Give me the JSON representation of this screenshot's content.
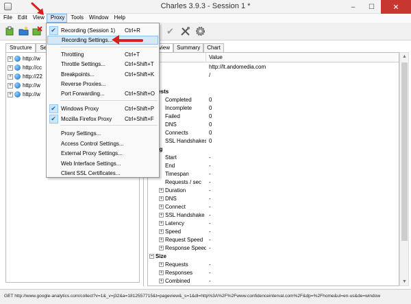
{
  "window": {
    "title": "Charles 3.9.3 - Session 1 *",
    "minimize_glyph": "–",
    "maximize_glyph": "☐",
    "close_glyph": "✕"
  },
  "menubar": [
    "File",
    "Edit",
    "View",
    "Proxy",
    "Tools",
    "Window",
    "Help"
  ],
  "proxy_menu": {
    "items": [
      {
        "label": "Recording (Session 1)",
        "shortcut": "Ctrl+R",
        "checked": true
      },
      {
        "label": "Recording Settings...",
        "shortcut": "",
        "checked": false,
        "highlighted": true
      },
      {
        "label": "Throttling",
        "shortcut": "Ctrl+T",
        "checked": false
      },
      {
        "label": "Throttle Settings...",
        "shortcut": "Ctrl+Shift+T",
        "checked": false
      },
      {
        "label": "Breakpoints...",
        "shortcut": "Ctrl+Shift+K",
        "checked": false
      },
      {
        "label": "Reverse Proxies...",
        "shortcut": "",
        "checked": false
      },
      {
        "label": "Port Forwarding...",
        "shortcut": "Ctrl+Shift+O",
        "checked": false
      },
      {
        "label": "Windows Proxy",
        "shortcut": "Ctrl+Shift+P",
        "checked": true
      },
      {
        "label": "Mozilla Firefox Proxy",
        "shortcut": "Ctrl+Shift+F",
        "checked": true
      },
      {
        "label": "Proxy Settings...",
        "shortcut": "",
        "checked": false
      },
      {
        "label": "Access Control Settings...",
        "shortcut": "",
        "checked": false
      },
      {
        "label": "External Proxy Settings...",
        "shortcut": "",
        "checked": false
      },
      {
        "label": "Web Interface Settings...",
        "shortcut": "",
        "checked": false
      },
      {
        "label": "Client SSL Certificates...",
        "shortcut": "",
        "checked": false
      }
    ],
    "check_glyph": "✔"
  },
  "left_tabs": [
    "Structure",
    "Seq"
  ],
  "tree": [
    "http://w",
    "http://cc",
    "http://22",
    "http://w",
    "http://w"
  ],
  "right_tabs": [
    "view",
    "Summary",
    "Chart"
  ],
  "table": {
    "headers": [
      "",
      "Value"
    ],
    "rows": [
      {
        "key": "ost",
        "value": "http://lt.andomedia.com",
        "level": 0,
        "bold": false
      },
      {
        "key": "ath",
        "value": "/",
        "level": 0,
        "bold": false
      },
      {
        "key": "otes",
        "value": "",
        "level": 0,
        "bold": false
      },
      {
        "key": "equests",
        "value": "",
        "level": 0,
        "bold": true
      },
      {
        "key": "Completed",
        "value": "0",
        "level": 1
      },
      {
        "key": "Incomplete",
        "value": "0",
        "level": 1
      },
      {
        "key": "Failed",
        "value": "0",
        "level": 1
      },
      {
        "key": "DNS",
        "value": "0",
        "level": 1
      },
      {
        "key": "Connects",
        "value": "0",
        "level": 1
      },
      {
        "key": "SSL Handshakes",
        "value": "0",
        "level": 1
      },
      {
        "key": "iming",
        "value": "",
        "level": 0,
        "bold": true
      },
      {
        "key": "Start",
        "value": "-",
        "level": 1
      },
      {
        "key": "End",
        "value": "-",
        "level": 1
      },
      {
        "key": "Timespan",
        "value": "-",
        "level": 1
      },
      {
        "key": "Requests / sec",
        "value": "-",
        "level": 1
      },
      {
        "key": "Duration",
        "value": "-",
        "level": 1,
        "expandable": true
      },
      {
        "key": "DNS",
        "value": "-",
        "level": 1,
        "expandable": true
      },
      {
        "key": "Connect",
        "value": "-",
        "level": 1,
        "expandable": true
      },
      {
        "key": "SSL Handshake",
        "value": "-",
        "level": 1,
        "expandable": true
      },
      {
        "key": "Latency",
        "value": "-",
        "level": 1,
        "expandable": true
      },
      {
        "key": "Speed",
        "value": "-",
        "level": 1,
        "expandable": true
      },
      {
        "key": "Request Speed",
        "value": "-",
        "level": 1,
        "expandable": true
      },
      {
        "key": "Response Speed",
        "value": "-",
        "level": 1,
        "expandable": true
      },
      {
        "key": "Size",
        "value": "",
        "level": 0,
        "bold": true,
        "collapsible": true
      },
      {
        "key": "Requests",
        "value": "-",
        "level": 1,
        "expandable": true
      },
      {
        "key": "Responses",
        "value": "-",
        "level": 1,
        "expandable": true
      },
      {
        "key": "Combined",
        "value": "-",
        "level": 1,
        "expandable": true
      }
    ]
  },
  "status_bar": "GET http://www.google-analytics.com/collect?v=1&_v=j32&a=1812557715&t=pageview&_s=1&dl=http%3A%2F%2Fwww.confidenceinterval.com%2F&dp=%2Fhome&ul=en-us&de=window",
  "colors": {
    "accent": "#2a5c9a",
    "highlight": "#d5e8f8",
    "close": "#c7372f",
    "annotation": "#d9201d"
  }
}
